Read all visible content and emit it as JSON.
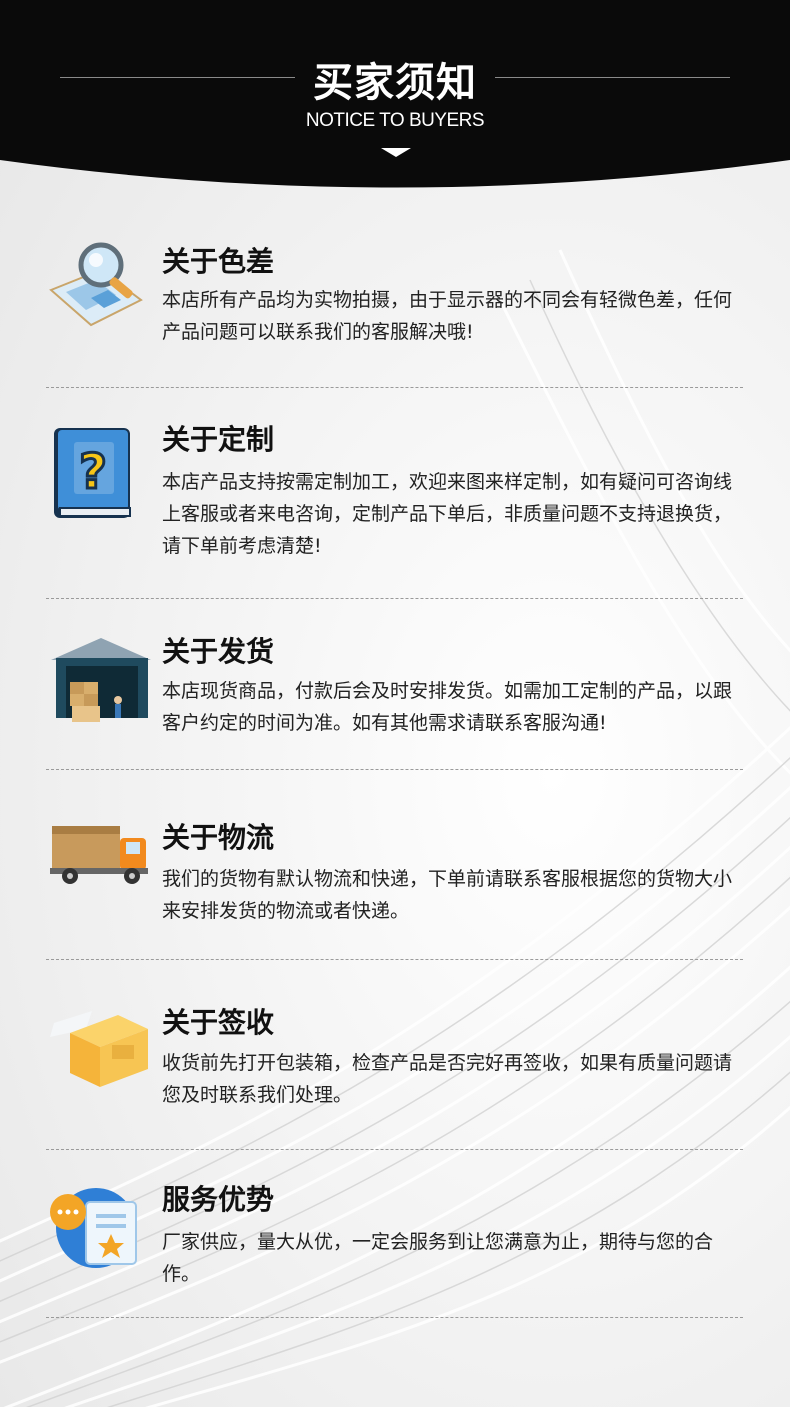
{
  "header": {
    "title_cn": "买家须知",
    "title_en": "NOTICE TO BUYERS"
  },
  "sections": [
    {
      "title": "关于色差",
      "text": "本店所有产品均为实物拍摄，由于显示器的不同会有轻微色差，任何产品问题可以联系我们的客服解决哦!",
      "icon": "magnifier-map-icon"
    },
    {
      "title": "关于定制",
      "text": "本店产品支持按需定制加工，欢迎来图来样定制，如有疑问可咨询线上客服或者来电咨询，定制产品下单后，非质量问题不支持退换货，请下单前考虑清楚!",
      "icon": "question-book-icon"
    },
    {
      "title": "关于发货",
      "text": "本店现货商品，付款后会及时安排发货。如需加工定制的产品，以跟客户约定的时间为准。如有其他需求请联系客服沟通!",
      "icon": "warehouse-icon"
    },
    {
      "title": "关于物流",
      "text": "我们的货物有默认物流和快递，下单前请联系客服根据您的货物大小来安排发货的物流或者快递。",
      "icon": "delivery-truck-icon"
    },
    {
      "title": "关于签收",
      "text": "收货前先打开包装箱，检查产品是否完好再签收，如果有质量问题请您及时联系我们处理。",
      "icon": "package-box-icon"
    },
    {
      "title": "服务优势",
      "text": "厂家供应，量大从优，一定会服务到让您满意为止，期待与您的合作。",
      "icon": "service-chat-icon"
    }
  ],
  "colors": {
    "header_bg": "#0a0a0a",
    "accent_blue": "#2f7fd6",
    "accent_orange": "#f3a526"
  }
}
